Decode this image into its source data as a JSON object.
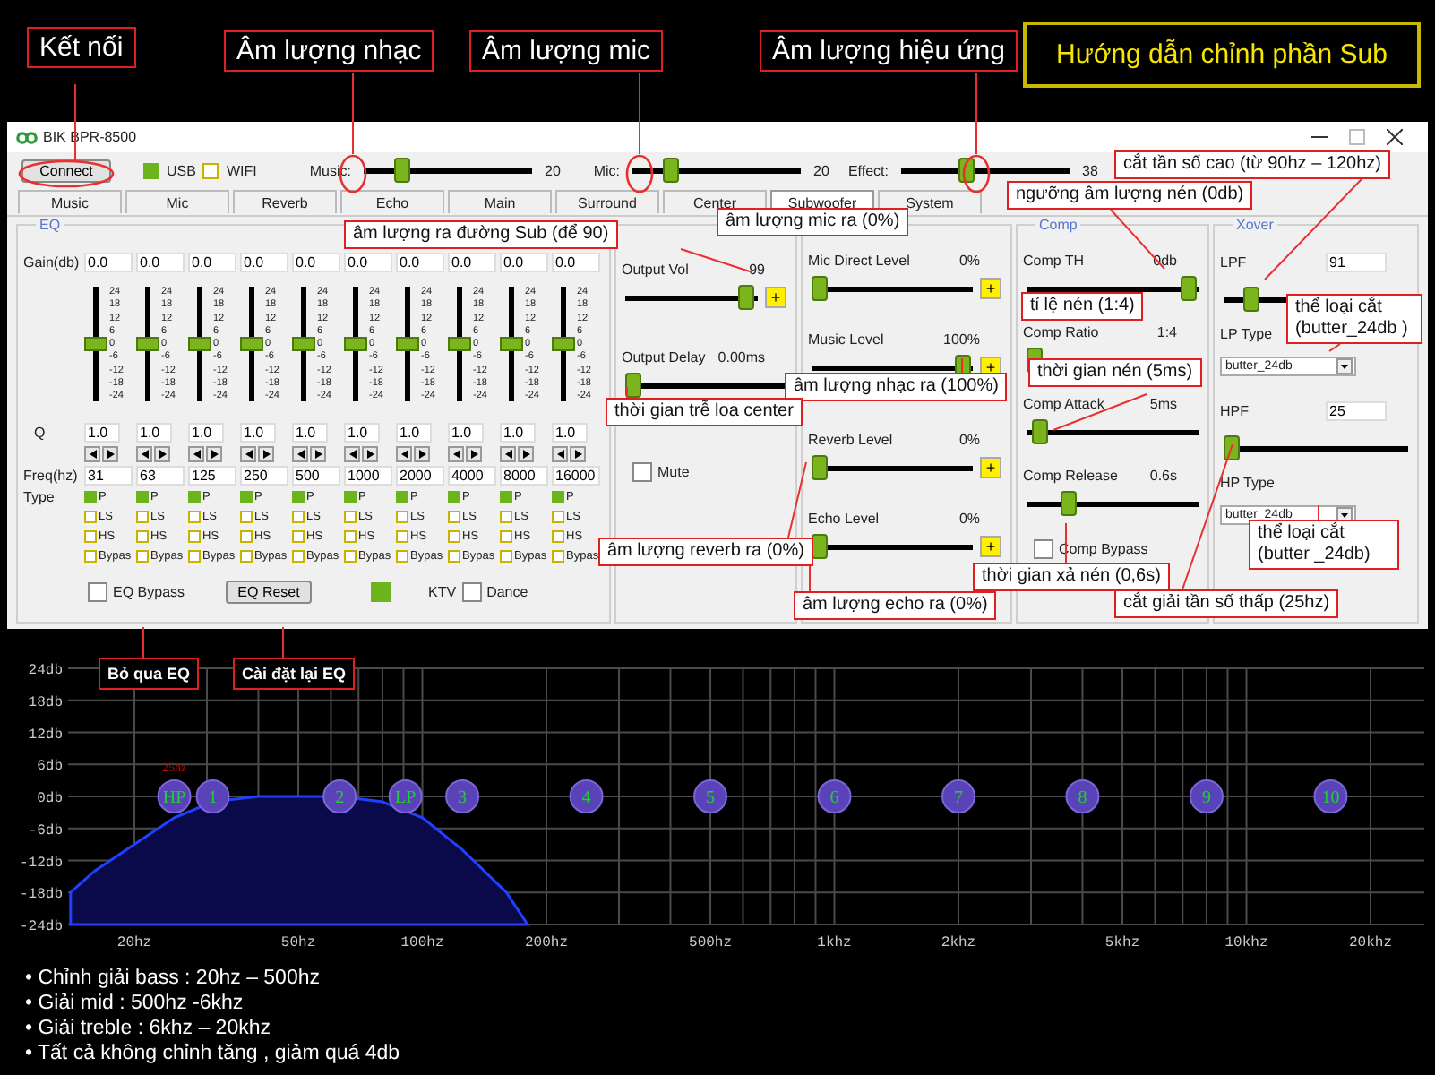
{
  "guide_title": "Hướng dẫn chỉnh phần Sub",
  "annotations": [
    {
      "text": "Kết nối",
      "kind": "large"
    },
    {
      "text": "Âm lượng nhạc",
      "kind": "large"
    },
    {
      "text": "Âm lượng mic",
      "kind": "large"
    },
    {
      "text": "Âm lượng hiệu ứng",
      "kind": "large"
    },
    {
      "text": "cắt tần số cao (từ 90hz – 120hz)",
      "kind": "small"
    },
    {
      "text": "ngưỡng âm lượng nén (0db)",
      "kind": "small"
    },
    {
      "text": "âm lượng mic ra (0%)",
      "kind": "small"
    },
    {
      "text": "âm lượng ra đường Sub (để 90)",
      "kind": "small"
    },
    {
      "text": "tỉ lệ nén (1:4)",
      "kind": "small"
    },
    {
      "text": "thể loại cắt (butter_24db )",
      "kind": "small"
    },
    {
      "text": "âm lượng nhạc ra (100%)",
      "kind": "small"
    },
    {
      "text": "thời gian nén (5ms)",
      "kind": "small"
    },
    {
      "text": "thời gian trễ loa center",
      "kind": "small"
    },
    {
      "text": "âm lượng reverb ra (0%)",
      "kind": "small"
    },
    {
      "text": "thời gian xả nén (0,6s)",
      "kind": "small"
    },
    {
      "text": "thể loại cắt (butter _24db)",
      "kind": "small"
    },
    {
      "text": "âm lượng echo ra (0%)",
      "kind": "small"
    },
    {
      "text": "cắt giải tần số thấp (25hz)",
      "kind": "small"
    },
    {
      "text": "Bỏ qua EQ",
      "kind": "tag"
    },
    {
      "text": "Cài đặt lại EQ",
      "kind": "tag"
    }
  ],
  "window": {
    "title": "BIK BPR-8500"
  },
  "toolbar": {
    "connect": "Connect",
    "usb": {
      "label": "USB",
      "checked": true
    },
    "wifi": {
      "label": "WIFI",
      "checked": false
    },
    "sliders": [
      {
        "label": "Music:",
        "level": 0.2,
        "reading": "20"
      },
      {
        "label": "Mic:",
        "level": 0.2,
        "reading": "20"
      },
      {
        "label": "Effect:",
        "level": 0.38,
        "reading": "38"
      }
    ]
  },
  "tabs": [
    {
      "label": "Music",
      "selected": false
    },
    {
      "label": "Mic",
      "selected": false
    },
    {
      "label": "Reverb",
      "selected": false
    },
    {
      "label": "Echo",
      "selected": false
    },
    {
      "label": "Main",
      "selected": false
    },
    {
      "label": "Surround",
      "selected": false
    },
    {
      "label": "Center",
      "selected": false
    },
    {
      "label": "Subwoofer",
      "selected": true
    },
    {
      "label": "System",
      "selected": false
    }
  ],
  "eq": {
    "title": "EQ",
    "gain_label": "Gain(db)",
    "q_label": "Q",
    "freq_label": "Freq(hz)",
    "type_label": "Type",
    "bands": [
      {
        "gain": "0.0",
        "level": 0.5,
        "scale": [
          "24",
          "18",
          "12",
          "6",
          "0",
          "-6",
          "-12",
          "-18",
          "-24"
        ],
        "q": "1.0",
        "freq": "31",
        "types": [
          {
            "label": "P",
            "checked": true
          },
          {
            "label": "LS",
            "checked": false
          },
          {
            "label": "HS",
            "checked": false
          },
          {
            "label": "Bypas",
            "checked": false
          }
        ]
      },
      {
        "gain": "0.0",
        "level": 0.5,
        "scale": [
          "24",
          "18",
          "12",
          "6",
          "0",
          "-6",
          "-12",
          "-18",
          "-24"
        ],
        "q": "1.0",
        "freq": "63",
        "types": [
          {
            "label": "P",
            "checked": true
          },
          {
            "label": "LS",
            "checked": false
          },
          {
            "label": "HS",
            "checked": false
          },
          {
            "label": "Bypas",
            "checked": false
          }
        ]
      },
      {
        "gain": "0.0",
        "level": 0.5,
        "scale": [
          "24",
          "18",
          "12",
          "6",
          "0",
          "-6",
          "-12",
          "-18",
          "-24"
        ],
        "q": "1.0",
        "freq": "125",
        "types": [
          {
            "label": "P",
            "checked": true
          },
          {
            "label": "LS",
            "checked": false
          },
          {
            "label": "HS",
            "checked": false
          },
          {
            "label": "Bypas",
            "checked": false
          }
        ]
      },
      {
        "gain": "0.0",
        "level": 0.5,
        "scale": [
          "24",
          "18",
          "12",
          "6",
          "0",
          "-6",
          "-12",
          "-18",
          "-24"
        ],
        "q": "1.0",
        "freq": "250",
        "types": [
          {
            "label": "P",
            "checked": true
          },
          {
            "label": "LS",
            "checked": false
          },
          {
            "label": "HS",
            "checked": false
          },
          {
            "label": "Bypas",
            "checked": false
          }
        ]
      },
      {
        "gain": "0.0",
        "level": 0.5,
        "scale": [
          "24",
          "18",
          "12",
          "6",
          "0",
          "-6",
          "-12",
          "-18",
          "-24"
        ],
        "q": "1.0",
        "freq": "500",
        "types": [
          {
            "label": "P",
            "checked": true
          },
          {
            "label": "LS",
            "checked": false
          },
          {
            "label": "HS",
            "checked": false
          },
          {
            "label": "Bypas",
            "checked": false
          }
        ]
      },
      {
        "gain": "0.0",
        "level": 0.5,
        "scale": [
          "24",
          "18",
          "12",
          "6",
          "0",
          "-6",
          "-12",
          "-18",
          "-24"
        ],
        "q": "1.0",
        "freq": "1000",
        "types": [
          {
            "label": "P",
            "checked": true
          },
          {
            "label": "LS",
            "checked": false
          },
          {
            "label": "HS",
            "checked": false
          },
          {
            "label": "Bypas",
            "checked": false
          }
        ]
      },
      {
        "gain": "0.0",
        "level": 0.5,
        "scale": [
          "24",
          "18",
          "12",
          "6",
          "0",
          "-6",
          "-12",
          "-18",
          "-24"
        ],
        "q": "1.0",
        "freq": "2000",
        "types": [
          {
            "label": "P",
            "checked": true
          },
          {
            "label": "LS",
            "checked": false
          },
          {
            "label": "HS",
            "checked": false
          },
          {
            "label": "Bypas",
            "checked": false
          }
        ]
      },
      {
        "gain": "0.0",
        "level": 0.5,
        "scale": [
          "24",
          "18",
          "12",
          "6",
          "0",
          "-6",
          "-12",
          "-18",
          "-24"
        ],
        "q": "1.0",
        "freq": "4000",
        "types": [
          {
            "label": "P",
            "checked": true
          },
          {
            "label": "LS",
            "checked": false
          },
          {
            "label": "HS",
            "checked": false
          },
          {
            "label": "Bypas",
            "checked": false
          }
        ]
      },
      {
        "gain": "0.0",
        "level": 0.5,
        "scale": [
          "24",
          "18",
          "12",
          "6",
          "0",
          "-6",
          "-12",
          "-18",
          "-24"
        ],
        "q": "1.0",
        "freq": "8000",
        "types": [
          {
            "label": "P",
            "checked": true
          },
          {
            "label": "LS",
            "checked": false
          },
          {
            "label": "HS",
            "checked": false
          },
          {
            "label": "Bypas",
            "checked": false
          }
        ]
      },
      {
        "gain": "0.0",
        "level": 0.5,
        "scale": [
          "24",
          "18",
          "12",
          "6",
          "0",
          "-6",
          "-12",
          "-18",
          "-24"
        ],
        "q": "1.0",
        "freq": "16000",
        "types": [
          {
            "label": "P",
            "checked": true
          },
          {
            "label": "LS",
            "checked": false
          },
          {
            "label": "HS",
            "checked": false
          },
          {
            "label": "Bypas",
            "checked": false
          }
        ]
      }
    ],
    "bypass": {
      "label": "EQ Bypass",
      "checked": false
    },
    "reset": "EQ Reset",
    "ktv": {
      "label": "KTV",
      "checked": true
    },
    "dance": {
      "label": "Dance",
      "checked": false
    }
  },
  "output": {
    "sliders": [
      {
        "label": "Output Vol",
        "reading": "99",
        "level": 0.99,
        "plus": "+"
      },
      {
        "label": "Output Delay",
        "reading": "0.00ms",
        "level": 0
      }
    ],
    "mute": {
      "label": "Mute",
      "checked": false
    }
  },
  "levels": [
    {
      "label": "Mic Direct Level",
      "reading": "0%",
      "level": 0,
      "plus": "+"
    },
    {
      "label": "Music Level",
      "reading": "100%",
      "level": 1,
      "plus": "+"
    },
    {
      "label": "Reverb Level",
      "reading": "0%",
      "level": 0,
      "plus": "+"
    },
    {
      "label": "Echo Level",
      "reading": "0%",
      "level": 0,
      "plus": "+"
    }
  ],
  "comp": {
    "title": "Comp",
    "sliders": [
      {
        "label": "Comp TH",
        "reading": "0db",
        "level": 1
      },
      {
        "label": "Comp Ratio",
        "reading": "1:4",
        "level": 0
      },
      {
        "label": "Comp Attack",
        "reading": "5ms",
        "level": 0.03
      },
      {
        "label": "Comp Release",
        "reading": "0.6s",
        "level": 0.22
      }
    ],
    "bypass": {
      "label": "Comp Bypass",
      "checked": false
    }
  },
  "xover": {
    "title": "Xover",
    "filters": [
      {
        "label": "LPF",
        "value": "91",
        "level": 0.12,
        "type_label": "LP Type",
        "type_value": "butter_24db"
      },
      {
        "label": "HPF",
        "value": "25",
        "level": 0,
        "type_label": "HP Type",
        "type_value": "butter_24db"
      }
    ]
  },
  "graph": {
    "marker_label": "25hz",
    "y_labels": [
      "24db",
      "18db",
      "12db",
      "6db",
      "0db",
      "-6db",
      "-12db",
      "-18db",
      "-24db"
    ],
    "x_labels": [
      "20hz",
      "50hz",
      "100hz",
      "200hz",
      "500hz",
      "1khz",
      "2khz",
      "5khz",
      "10khz",
      "20khz"
    ],
    "nodes": [
      "HP",
      "1",
      "2",
      "LP",
      "3",
      "4",
      "5",
      "6",
      "7",
      "8",
      "9",
      "10"
    ]
  },
  "notes": [
    "• Chỉnh giải bass : 20hz – 500hz",
    "• Giải mid : 500hz -6khz",
    "• Giải treble : 6khz – 20khz",
    "• Tất cả không chỉnh tăng , giảm quá 4db"
  ]
}
